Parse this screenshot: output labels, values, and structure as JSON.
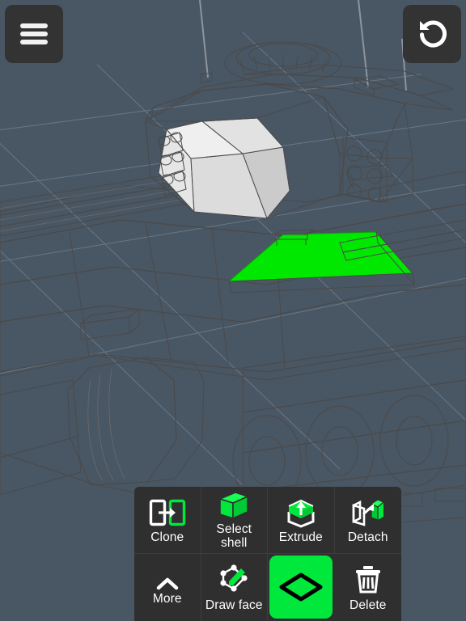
{
  "app": {
    "name": "3d-modeling-editor",
    "background_color": "#495663",
    "accent_green": "#00e83c",
    "panel_color": "#2f2f2f",
    "button_color": "#333333"
  },
  "viewport": {
    "name": "3d-viewport",
    "model_description": "low-poly military tank, perspective view",
    "grid_visible": true,
    "grid_color": "#6e7b88",
    "selection": {
      "type": "face",
      "color": "#00e800",
      "count": 1
    },
    "model_colors": {
      "light": "#e2e2e2",
      "mid": "#c9c9c9",
      "dark": "#a8a8a8",
      "darker": "#909090",
      "edge": "#4a4a4a"
    }
  },
  "top_bar": {
    "menu_button": {
      "icon": "hamburger-menu-icon",
      "label": ""
    },
    "undo_button": {
      "icon": "undo-arrow-icon",
      "label": ""
    }
  },
  "toolbar": {
    "rows": 2,
    "columns": 4,
    "tools": [
      {
        "id": "clone",
        "label": "Clone",
        "icon": "clone-icon",
        "active": false
      },
      {
        "id": "select-shell",
        "label": "Select shell",
        "icon": "cube-icon",
        "active": false
      },
      {
        "id": "extrude",
        "label": "Extrude",
        "icon": "extrude-icon",
        "active": false
      },
      {
        "id": "detach",
        "label": "Detach",
        "icon": "detach-icon",
        "active": false
      },
      {
        "id": "more",
        "label": "More",
        "icon": "chevron-up-icon",
        "active": false
      },
      {
        "id": "draw-face",
        "label": "Draw face",
        "icon": "draw-face-icon",
        "active": false
      },
      {
        "id": "select-face",
        "label": "",
        "icon": "face-diamond-icon",
        "active": true
      },
      {
        "id": "delete",
        "label": "Delete",
        "icon": "trash-icon",
        "active": false
      }
    ]
  }
}
